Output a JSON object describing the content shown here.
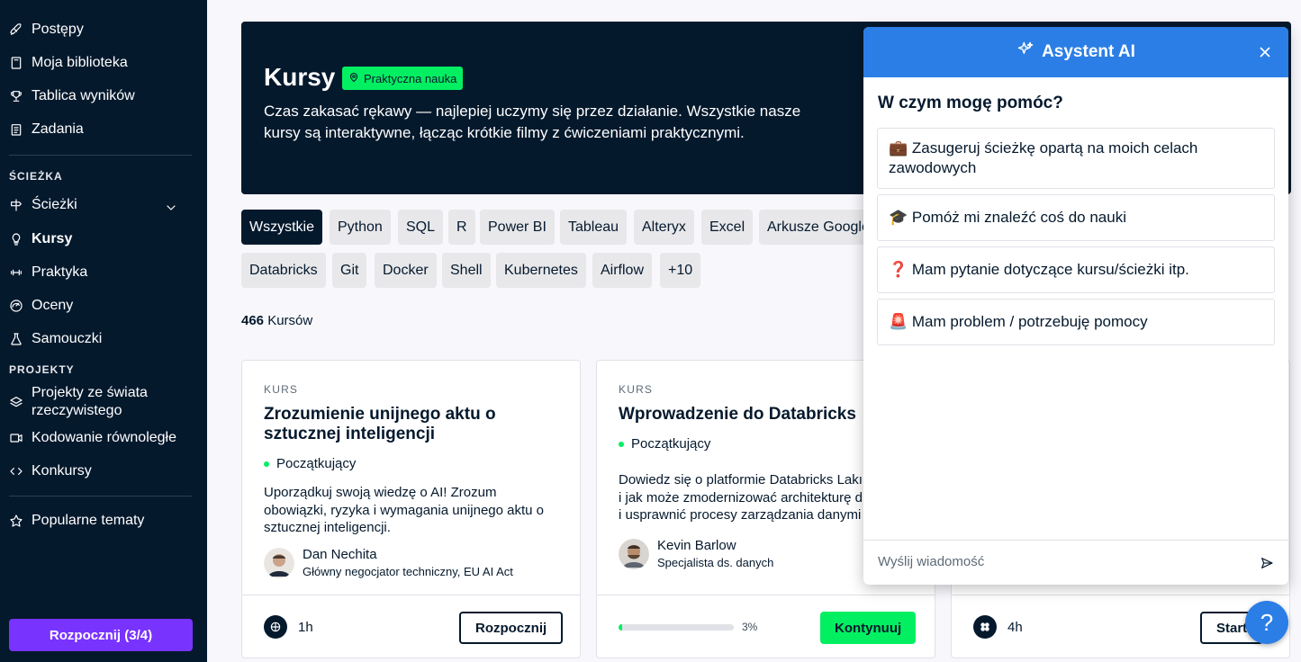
{
  "sidebar": {
    "items_top": [
      {
        "label": "Postępy",
        "icon": "rocket-icon"
      },
      {
        "label": "Moja biblioteka",
        "icon": "book-icon"
      },
      {
        "label": "Tablica wyników",
        "icon": "trophy-icon"
      },
      {
        "label": "Zadania",
        "icon": "clipboard-icon"
      }
    ],
    "section_path": "ŚCIEŻKA",
    "items_path": [
      {
        "label": "Ścieżki",
        "icon": "signpost-icon"
      },
      {
        "label": "Kursy",
        "icon": "lightbulb-icon",
        "active": true
      },
      {
        "label": "Praktyka",
        "icon": "dumbbell-icon"
      },
      {
        "label": "Oceny",
        "icon": "gauge-icon"
      },
      {
        "label": "Samouczki",
        "icon": "flask-icon"
      }
    ],
    "section_projects": "PROJEKTY",
    "items_projects": [
      {
        "label": "Projekty ze świata rzeczywistego",
        "icon": "layers-icon"
      },
      {
        "label": "Kodowanie równoległe",
        "icon": "video-icon"
      },
      {
        "label": "Konkursy",
        "icon": "code-icon"
      }
    ],
    "popular": {
      "label": "Popularne tematy",
      "icon": "star-icon"
    },
    "start_button": "Rozpocznij (3/4)"
  },
  "hero": {
    "title": "Kursy",
    "badge": "Praktyczna nauka",
    "description": "Czas zakasać rękawy — najlepiej uczymy się przez działanie. Wszystkie nasze kursy są interaktywne, łącząc krótkie filmy z ćwiczeniami praktycznymi."
  },
  "filters": {
    "row1": [
      "Wszystkie",
      "Python",
      "SQL",
      "R",
      "Power BI",
      "Tableau",
      "Alteryx",
      "Excel",
      "Arkusze Google"
    ],
    "row2": [
      "Databricks",
      "Git",
      "Docker",
      "Shell",
      "Kubernetes",
      "Airflow",
      "+10"
    ]
  },
  "results": {
    "count": "466",
    "label": "Kursów"
  },
  "cards": [
    {
      "kind": "KURS",
      "title": "Zrozumienie unijnego aktu o sztucznej inteligencji",
      "level": "Początkujący",
      "desc": [
        "Uporządkuj swoją wiedzę o AI! Zrozum",
        "obowiązki, ryzyka i wymagania unijnego aktu o",
        "sztucznej inteligencji."
      ],
      "author_name": "Dan Nechita",
      "author_role": "Główny negocjator techniczny, EU AI Act",
      "duration": "1h",
      "button": "Rozpocznij"
    },
    {
      "kind": "KURS",
      "title": "Wprowadzenie do Databricks",
      "level": "Początkujący",
      "desc": [
        "Dowiedz się o platformie Databricks Lakı",
        "i jak może zmodernizować architekturę d",
        "i usprawnić procesy zarządzania danymi"
      ],
      "author_name": "Kevin Barlow",
      "author_role": "Specjalista ds. danych",
      "progress_label": "3%",
      "progress": 0.03,
      "button": "Kontynuuj"
    },
    {
      "duration": "4h",
      "button": "Start"
    }
  ],
  "ai": {
    "title": "Asystent AI",
    "question": "W czym mogę pomóc?",
    "options": [
      "💼 Zasugeruj ścieżkę opartą na moich celach zawodowych",
      "🎓 Pomóż mi znaleźć coś do nauki",
      "❓ Mam pytanie dotyczące kursu/ścieżki itp.",
      "🚨 Mam problem / potrzebuję pomocy"
    ],
    "input_placeholder": "Wyślij wiadomość"
  },
  "help_label": "?",
  "colors": {
    "navy": "#05192d",
    "green": "#03ef62",
    "purple": "#7933ff",
    "blue": "#2b7ee6"
  }
}
